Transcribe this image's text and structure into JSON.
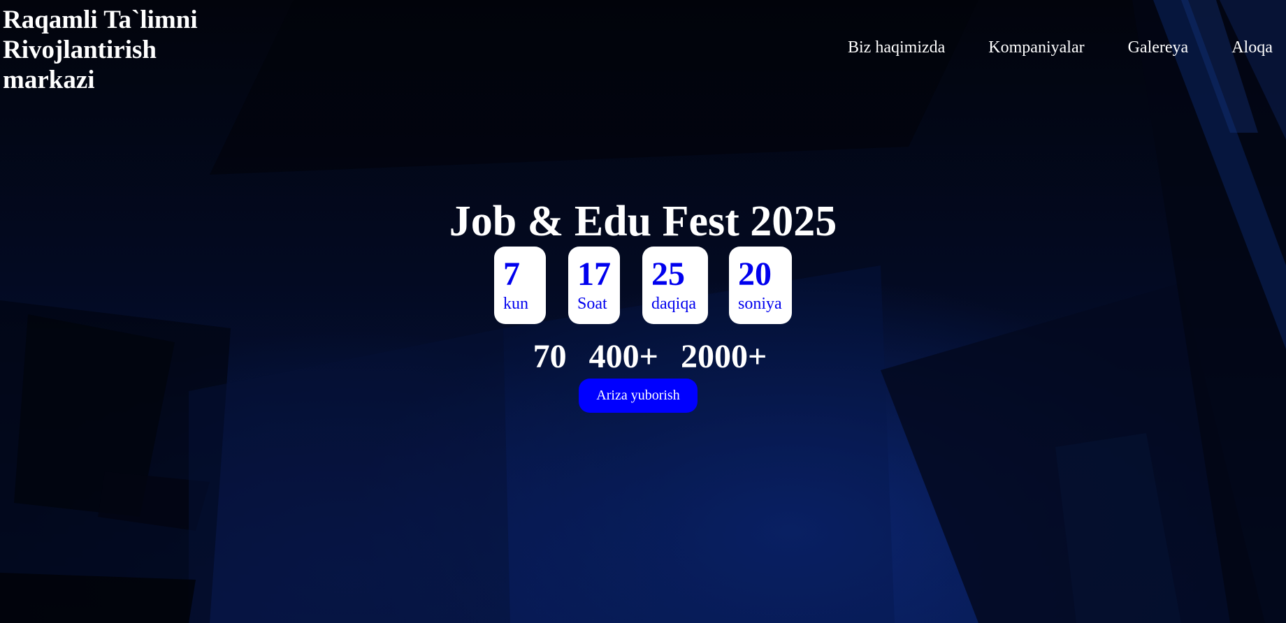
{
  "header": {
    "brand_title": "Raqamli Ta`limni Rivojlantirish markazi",
    "nav": [
      {
        "label": "Biz haqimizda"
      },
      {
        "label": "Kompaniyalar"
      },
      {
        "label": "Galereya"
      },
      {
        "label": "Aloqa"
      }
    ]
  },
  "hero": {
    "title": "Job & Edu Fest 2025",
    "countdown": [
      {
        "value": "7",
        "unit": "kun"
      },
      {
        "value": "17",
        "unit": "Soat"
      },
      {
        "value": "25",
        "unit": "daqiqa"
      },
      {
        "value": "20",
        "unit": "soniya"
      }
    ],
    "stats": [
      "70",
      "400+",
      "2000+"
    ],
    "cta_label": "Ariza yuborish"
  },
  "colors": {
    "accent": "#0000ff",
    "countdown_text": "#0000ee",
    "background": "#02050f"
  }
}
